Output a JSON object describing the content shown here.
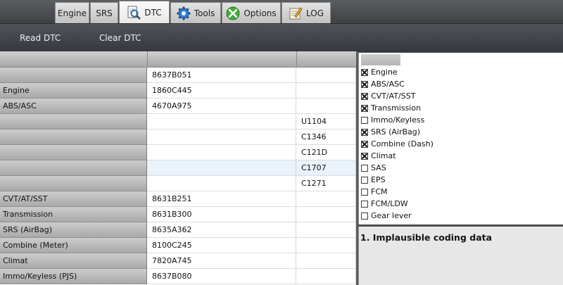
{
  "tabs": [
    {
      "label": "Engine",
      "icon": "",
      "active": false
    },
    {
      "label": "SRS",
      "icon": "",
      "active": false
    },
    {
      "label": "DTC",
      "icon": "magnifier-icon",
      "active": true
    },
    {
      "label": "Tools",
      "icon": "gear-icon",
      "active": false
    },
    {
      "label": "Options",
      "icon": "options-icon",
      "active": false
    },
    {
      "label": "LOG",
      "icon": "log-icon",
      "active": false
    }
  ],
  "toolbar": {
    "read_label": "Read DTC",
    "clear_label": "Clear DTC"
  },
  "grid": {
    "rows": [
      {
        "module": "",
        "code": "8637B051",
        "dtc": ""
      },
      {
        "module": "Engine",
        "code": "1860C445",
        "dtc": ""
      },
      {
        "module": "ABS/ASC",
        "code": "4670A975",
        "dtc": ""
      },
      {
        "module": "",
        "code": "",
        "dtc": "U1104"
      },
      {
        "module": "",
        "code": "",
        "dtc": "C1346"
      },
      {
        "module": "",
        "code": "",
        "dtc": "C121D"
      },
      {
        "module": "",
        "code": "",
        "dtc": "C1707",
        "selected": true
      },
      {
        "module": "",
        "code": "",
        "dtc": "C1271"
      },
      {
        "module": "CVT/AT/SST",
        "code": "8631B251",
        "dtc": ""
      },
      {
        "module": "Transmission",
        "code": "8631B300",
        "dtc": ""
      },
      {
        "module": "SRS (AirBag)",
        "code": "8635A362",
        "dtc": ""
      },
      {
        "module": "Combine (Meter)",
        "code": "8100C245",
        "dtc": ""
      },
      {
        "module": "Climat",
        "code": "7820A745",
        "dtc": ""
      },
      {
        "module": "Immo/Keyless (PJS)",
        "code": "8637B080",
        "dtc": ""
      }
    ]
  },
  "modules": [
    {
      "label": "Engine",
      "checked": true
    },
    {
      "label": "ABS/ASC",
      "checked": true
    },
    {
      "label": "CVT/AT/SST",
      "checked": true
    },
    {
      "label": "Transmission",
      "checked": true
    },
    {
      "label": "Immo/Keyless",
      "checked": false
    },
    {
      "label": "SRS (AirBag)",
      "checked": true
    },
    {
      "label": "Combine (Dash)",
      "checked": true
    },
    {
      "label": "Climat",
      "checked": true
    },
    {
      "label": "SAS",
      "checked": false
    },
    {
      "label": "EPS",
      "checked": false
    },
    {
      "label": "FCM",
      "checked": false
    },
    {
      "label": "FCM/LDW",
      "checked": false
    },
    {
      "label": "Gear lever",
      "checked": false
    }
  ],
  "message": "1. Implausible coding data"
}
